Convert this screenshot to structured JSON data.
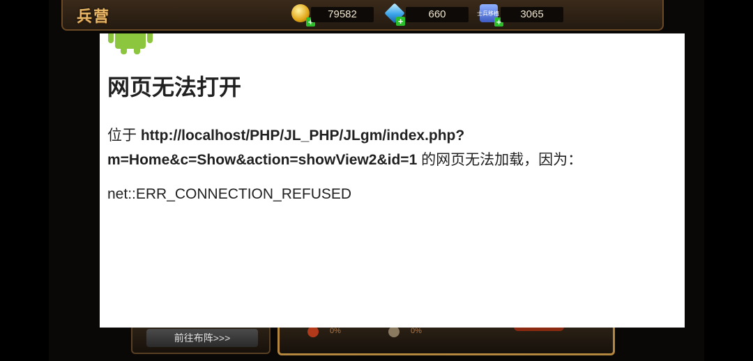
{
  "topbar": {
    "title": "兵营",
    "gold": "79582",
    "gems": "660",
    "soldiers": "3065",
    "soldier_icon_caption": "士兵移植"
  },
  "bottom": {
    "goto_label": "前往布阵>>>",
    "stat1": "0%",
    "stat2": "0%"
  },
  "error": {
    "title": "网页无法打开",
    "prefix": "位于 ",
    "url_part1": "http://localhost/PHP/JL_PHP/JLgm/index.php?",
    "url_part2": "m=Home&c=Show&action=showView2&id=1",
    "suffix": " 的网页无法加载，因为：",
    "code": "net::ERR_CONNECTION_REFUSED"
  },
  "colors": {
    "dialog_bg": "#ffffff",
    "android_green": "#8cc63f",
    "game_gold": "#e8b766"
  },
  "icons": [
    "coin-icon",
    "gem-icon",
    "soldier-icon",
    "plus-icon",
    "android-icon"
  ]
}
